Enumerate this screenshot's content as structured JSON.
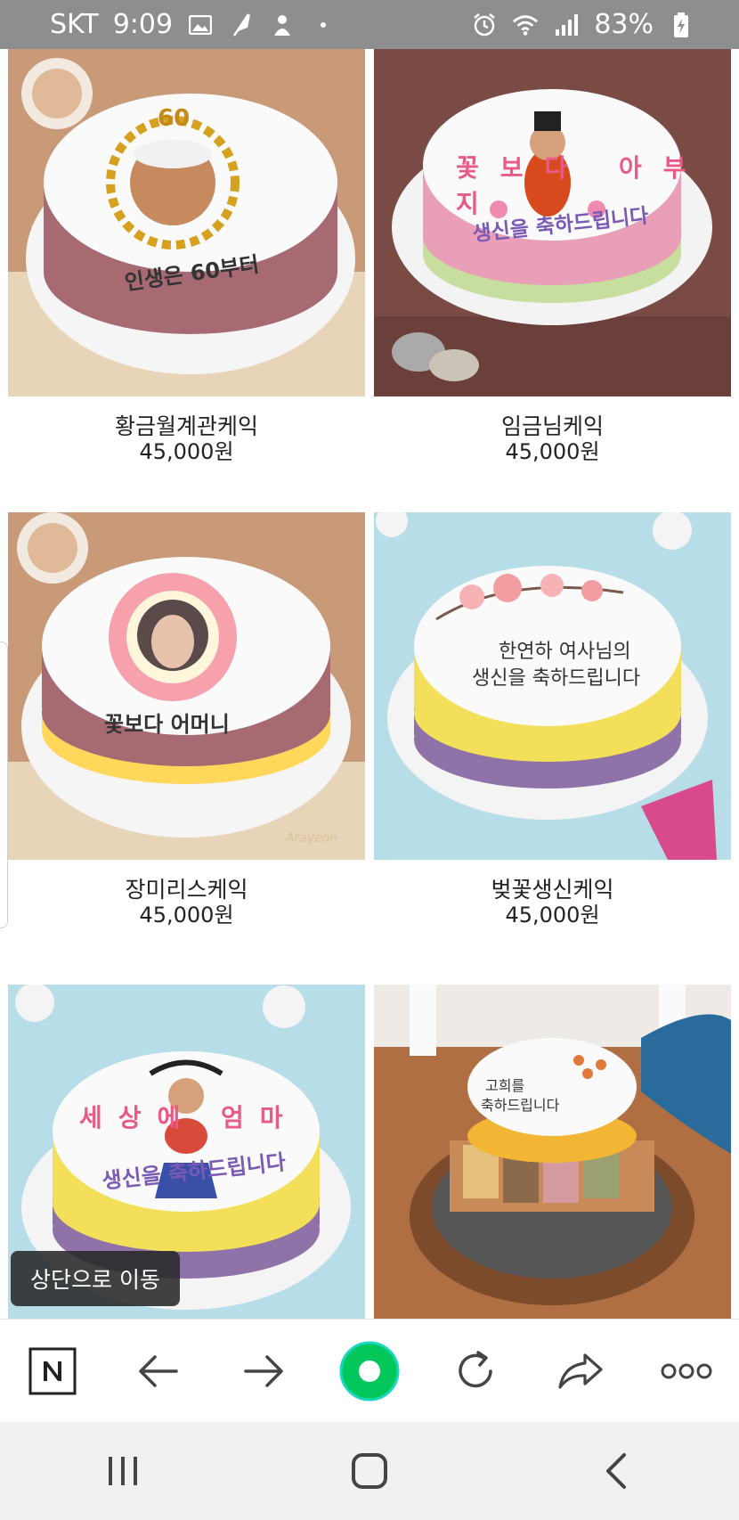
{
  "status_bar": {
    "carrier": "SKT",
    "time": "9:09",
    "battery": "83%",
    "icons": [
      "gallery-icon",
      "feather-icon",
      "app-icon",
      "dot-icon",
      "alarm-icon",
      "wifi-icon",
      "signal-icon",
      "battery-charging-icon"
    ]
  },
  "products": [
    {
      "name": "황금월계관케익",
      "price": "45,000원",
      "image_text": [
        "60",
        "인생은 60부터"
      ]
    },
    {
      "name": "임금님케익",
      "price": "45,000원",
      "image_text": [
        "꽃보다 아부지",
        "생신을 축하드립니다"
      ]
    },
    {
      "name": "장미리스케익",
      "price": "45,000원",
      "image_text": [
        "꽃보다 어머니",
        "Arayeon"
      ]
    },
    {
      "name": "벚꽃생신케익",
      "price": "45,000원",
      "image_text": [
        "한연하 여사님의",
        "생신을 축하드립니다"
      ]
    },
    {
      "name": "",
      "price": "",
      "image_text": [
        "세상에 엄마",
        "생신을 축하드립니다"
      ]
    },
    {
      "name": "",
      "price": "",
      "image_text": [
        "고희를",
        "축하드립니다"
      ]
    }
  ],
  "scroll_top_label": "상단으로 이동",
  "toolbar": {
    "items": [
      "naver-home-icon",
      "back-arrow-icon",
      "forward-arrow-icon",
      "green-dot-icon",
      "refresh-icon",
      "share-icon",
      "more-icon"
    ]
  },
  "system_nav": {
    "items": [
      "recent-apps-icon",
      "home-icon",
      "back-icon"
    ]
  }
}
